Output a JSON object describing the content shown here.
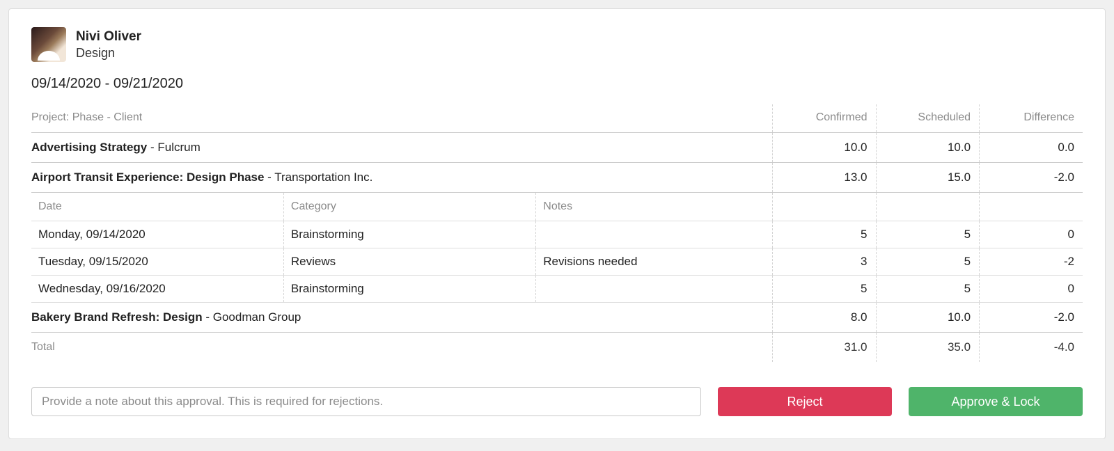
{
  "user": {
    "name": "Nivi Oliver",
    "role": "Design"
  },
  "date_range": "09/14/2020 - 09/21/2020",
  "table": {
    "header": {
      "project": "Project: Phase - Client",
      "confirmed": "Confirmed",
      "scheduled": "Scheduled",
      "difference": "Difference"
    },
    "sub_header": {
      "date": "Date",
      "category": "Category",
      "notes": "Notes"
    },
    "projects": [
      {
        "name": "Advertising Strategy",
        "client": " - Fulcrum",
        "confirmed": "10.0",
        "scheduled": "10.0",
        "difference": "0.0"
      },
      {
        "name": "Airport Transit Experience: Design Phase",
        "client": " - Transportation Inc.",
        "confirmed": "13.0",
        "scheduled": "15.0",
        "difference": "-2.0",
        "entries": [
          {
            "date": "Monday, 09/14/2020",
            "category": "Brainstorming",
            "notes": "",
            "confirmed": "5",
            "scheduled": "5",
            "difference": "0"
          },
          {
            "date": "Tuesday, 09/15/2020",
            "category": "Reviews",
            "notes": "Revisions needed",
            "confirmed": "3",
            "scheduled": "5",
            "difference": "-2"
          },
          {
            "date": "Wednesday, 09/16/2020",
            "category": "Brainstorming",
            "notes": "",
            "confirmed": "5",
            "scheduled": "5",
            "difference": "0"
          }
        ]
      },
      {
        "name": "Bakery Brand Refresh: Design",
        "client": " - Goodman Group",
        "confirmed": "8.0",
        "scheduled": "10.0",
        "difference": "-2.0"
      }
    ],
    "total": {
      "label": "Total",
      "confirmed": "31.0",
      "scheduled": "35.0",
      "difference": "-4.0"
    }
  },
  "actions": {
    "note_placeholder": "Provide a note about this approval. This is required for rejections.",
    "reject_label": "Reject",
    "approve_label": "Approve & Lock"
  }
}
